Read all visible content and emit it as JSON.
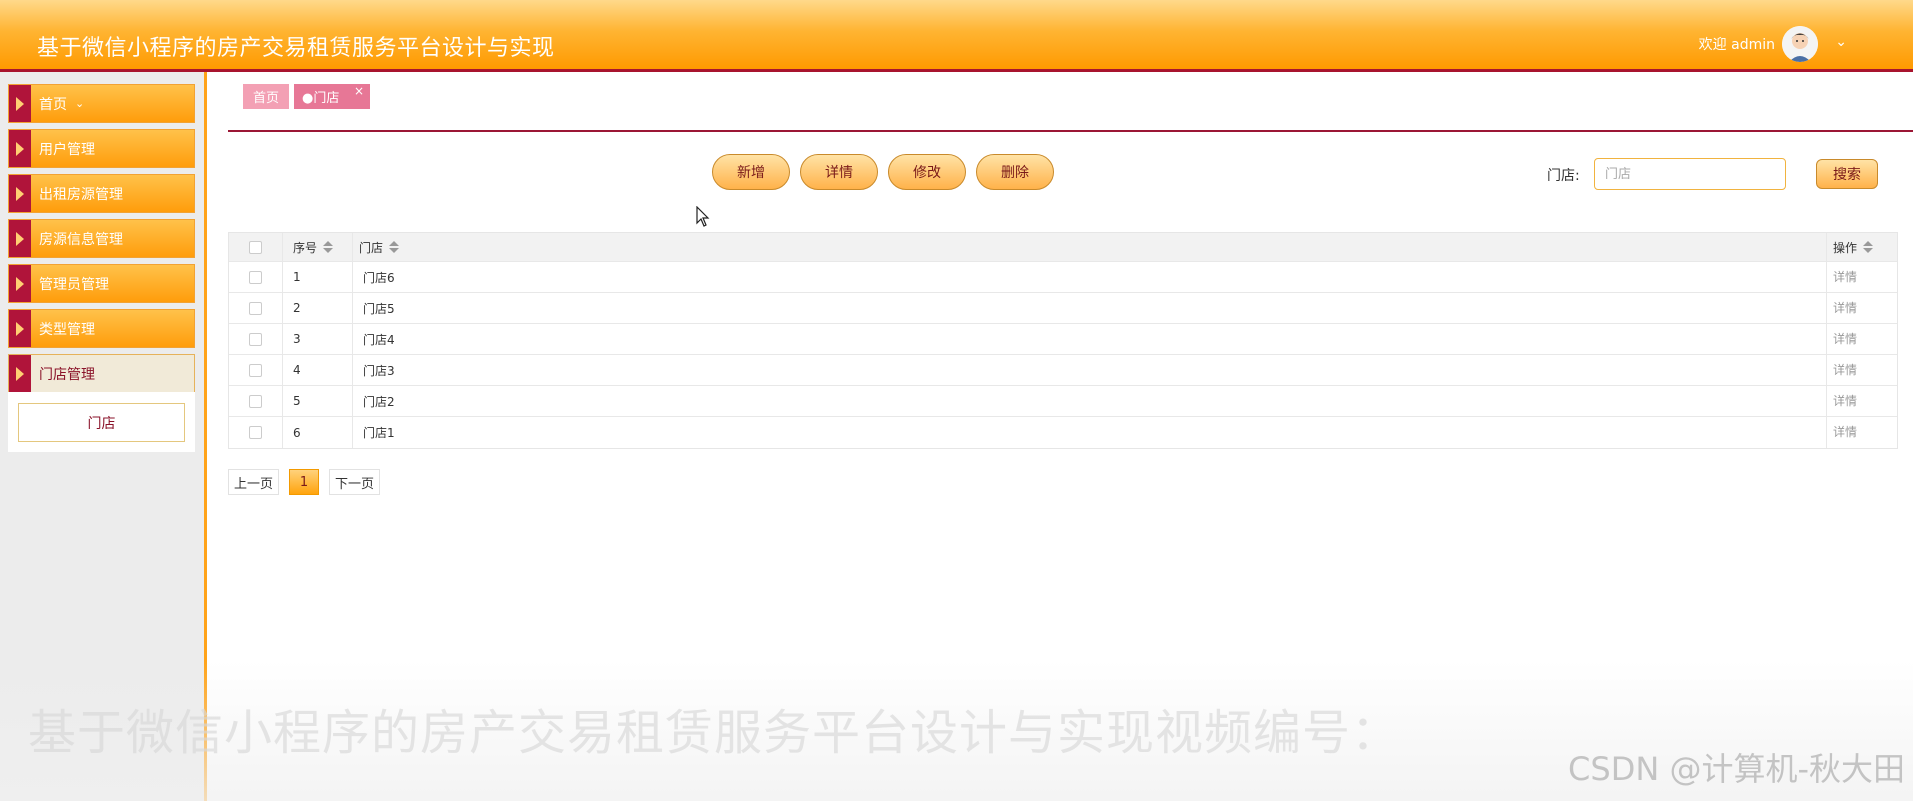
{
  "header": {
    "title": "基于微信小程序的房产交易租赁服务平台设计与实现",
    "welcome": "欢迎 admin",
    "chevron": "⌄"
  },
  "sidebar": {
    "items": [
      {
        "label": "首页",
        "suffix": "⌄"
      },
      {
        "label": "用户管理"
      },
      {
        "label": "出租房源管理"
      },
      {
        "label": "房源信息管理"
      },
      {
        "label": "管理员管理"
      },
      {
        "label": "类型管理"
      },
      {
        "label": "门店管理"
      }
    ],
    "submenu": [
      {
        "label": "门店"
      }
    ]
  },
  "tabs": {
    "home": "首页",
    "current": "●门店",
    "close": "×"
  },
  "toolbar": {
    "add": "新增",
    "detail": "详情",
    "edit": "修改",
    "delete": "删除",
    "search_label": "门店:",
    "search_placeholder": "门店",
    "search_button": "搜索"
  },
  "table": {
    "columns": [
      "序号",
      "门店",
      "操作"
    ],
    "rows": [
      {
        "index": "1",
        "name": "门店6",
        "action": "详情"
      },
      {
        "index": "2",
        "name": "门店5",
        "action": "详情"
      },
      {
        "index": "3",
        "name": "门店4",
        "action": "详情"
      },
      {
        "index": "4",
        "name": "门店3",
        "action": "详情"
      },
      {
        "index": "5",
        "name": "门店2",
        "action": "详情"
      },
      {
        "index": "6",
        "name": "门店1",
        "action": "详情"
      }
    ]
  },
  "pagination": {
    "prev": "上一页",
    "current": "1",
    "next": "下一页"
  },
  "overlay": {
    "caption": "基于微信小程序的房产交易租赁服务平台设计与实现视频编号：",
    "watermark": "CSDN @计算机-秋大田"
  },
  "colors": {
    "accent": "#ff9a00",
    "brand_dark": "#a8142e",
    "tab_pink": "#e77796"
  }
}
